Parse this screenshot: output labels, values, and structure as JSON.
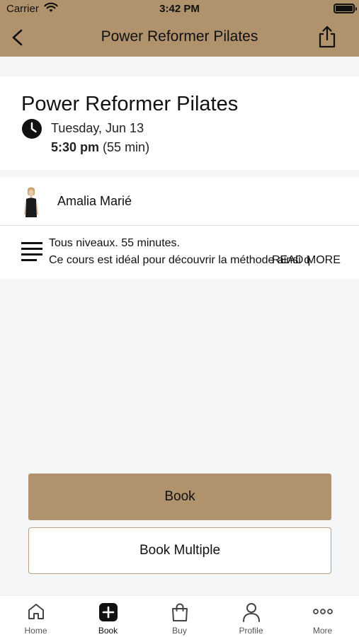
{
  "status_bar": {
    "carrier": "Carrier",
    "time": "3:42 PM"
  },
  "nav": {
    "title": "Power Reformer Pilates",
    "back_icon": "chevron-left-icon",
    "share_icon": "share-icon"
  },
  "class": {
    "title": "Power Reformer Pilates",
    "date": "Tuesday, Jun 13",
    "time": "5:30 pm",
    "duration": "(55 min)"
  },
  "instructor": {
    "name": "Amalia Marié"
  },
  "description": {
    "line1": "Tous niveaux. 55 minutes.",
    "line2": "Ce cours est idéal pour découvrir la méthode ainsi q",
    "read_more": "READ MORE"
  },
  "actions": {
    "book": "Book",
    "book_multiple": "Book Multiple"
  },
  "tabs": [
    {
      "label": "Home",
      "icon": "home-icon"
    },
    {
      "label": "Book",
      "icon": "plus-square-icon"
    },
    {
      "label": "Buy",
      "icon": "shopping-bag-icon"
    },
    {
      "label": "Profile",
      "icon": "person-icon"
    },
    {
      "label": "More",
      "icon": "more-dots-icon"
    }
  ],
  "colors": {
    "brand": "#b0926c",
    "background": "#f5f6f8"
  }
}
